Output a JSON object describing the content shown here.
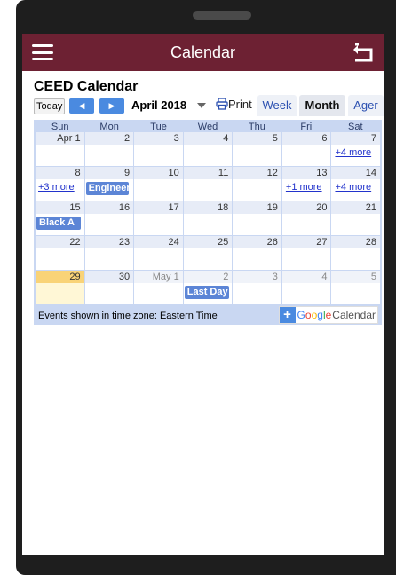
{
  "appbar": {
    "title": "Calendar"
  },
  "calendar": {
    "title": "CEED Calendar",
    "today_label": "Today",
    "month_label": "April 2018",
    "print_label": "Print",
    "tabs": [
      "Week",
      "Month",
      "Ager"
    ],
    "active_tab": "Month",
    "weekdays": [
      "Sun",
      "Mon",
      "Tue",
      "Wed",
      "Thu",
      "Fri",
      "Sat"
    ],
    "weeks": [
      {
        "days": [
          "Apr 1",
          "2",
          "3",
          "4",
          "5",
          "6",
          "7"
        ]
      },
      {
        "days": [
          "8",
          "9",
          "10",
          "11",
          "12",
          "13",
          "14"
        ]
      },
      {
        "days": [
          "15",
          "16",
          "17",
          "18",
          "19",
          "20",
          "21"
        ]
      },
      {
        "days": [
          "22",
          "23",
          "24",
          "25",
          "26",
          "27",
          "28"
        ]
      },
      {
        "days": [
          "29",
          "30",
          "May 1",
          "2",
          "3",
          "4",
          "5"
        ]
      }
    ],
    "more_links": {
      "w1_sat": "+4 more",
      "w2_sun": "+3 more",
      "w2_fri": "+1 more",
      "w2_sat": "+4 more"
    },
    "events": {
      "engineering": "Engineer",
      "black": "Black A",
      "last_day": "Last Day"
    },
    "timezone_text": "Events shown in time zone: Eastern Time",
    "google_badge": {
      "plus": "+",
      "google": "Google",
      "calendar": "Calendar"
    },
    "colors": {
      "appbar": "#6d2133",
      "event": "#5c85d6",
      "today": "#f9d377"
    }
  }
}
